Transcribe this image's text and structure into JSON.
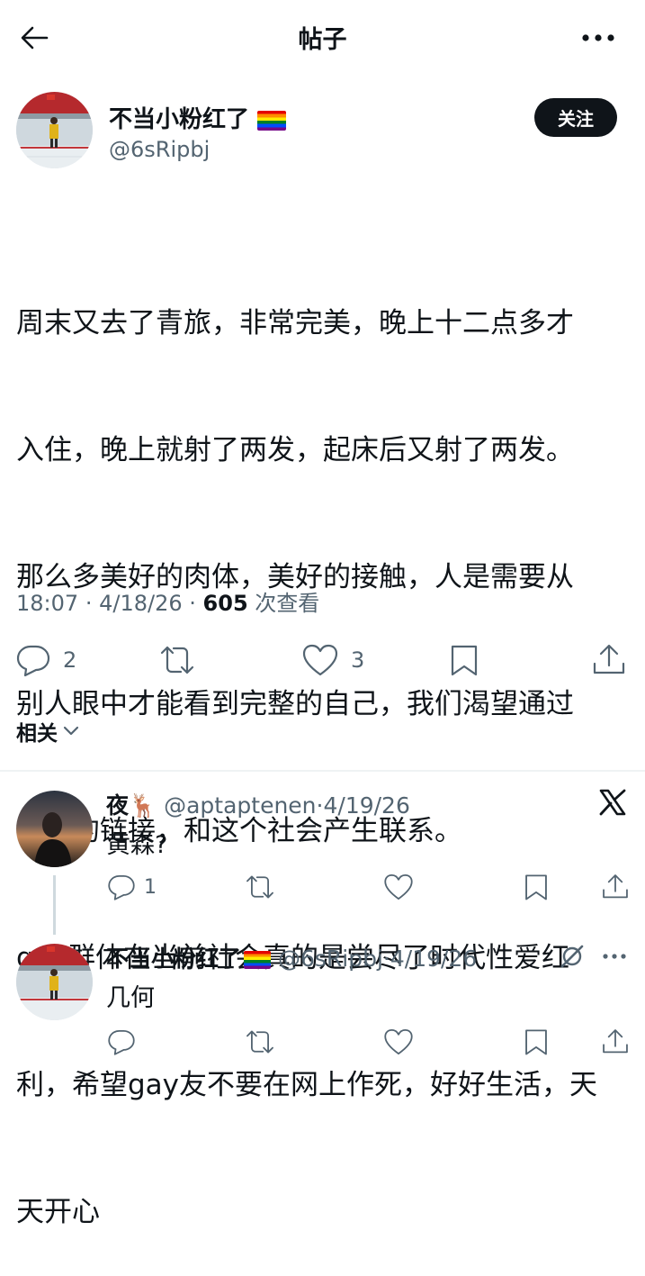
{
  "header": {
    "title": "帖子"
  },
  "post": {
    "author_name": "不当小粉红了",
    "author_handle": "@6sRipbj",
    "follow_label": "关注",
    "lines": [
      "周末又去了青旅，非常完美，晚上十二点多才",
      "入住，晚上就射了两发，起床后又射了两发。",
      "那么多美好的肉体，美好的接触，人是需要从",
      "别人眼中才能看到完整的自己，我们渴望通过",
      "与人的链接，和这个社会产生联系。",
      "gay群体在当前社会真的是尝尽了时代性爱红",
      "利，希望gay友不要在网上作死，好好生活，天",
      "天开心"
    ],
    "time": "18:07",
    "date": "4/18/26",
    "views_count": "605",
    "views_label": "次查看",
    "reply_count": "2",
    "like_count": "3"
  },
  "related_label": "相关",
  "replies": [
    {
      "name": "夜🦌",
      "handle": "@aptaptenen",
      "date": "4/19/26",
      "text": "黄森?",
      "reply_count": "1"
    },
    {
      "name": "不当小粉红了",
      "handle": "@6sRipbj",
      "date": "4/19/26",
      "text": "几何"
    }
  ],
  "sep": "·",
  "colors": {
    "text": "#0f1419",
    "secondary": "#536471",
    "divider": "#eff3f4",
    "button": "#0f1419"
  }
}
